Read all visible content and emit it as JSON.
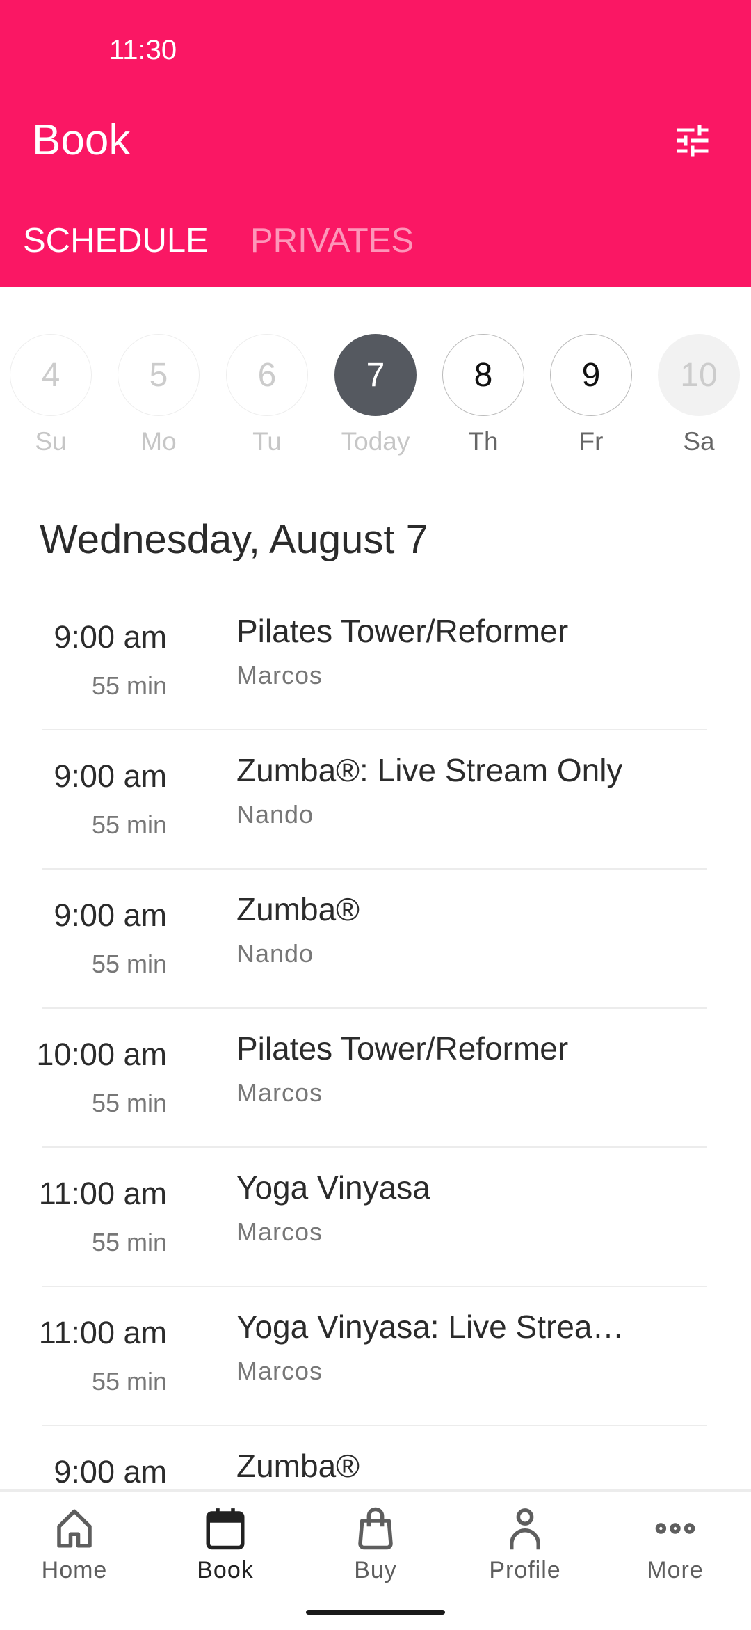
{
  "status_bar": {
    "time": "11:30"
  },
  "header": {
    "title": "Book",
    "filter_icon": "sliders-icon",
    "brand_color": "#fa1764"
  },
  "tabs": [
    {
      "label": "SCHEDULE",
      "active": true
    },
    {
      "label": "PRIVATES",
      "active": false
    }
  ],
  "days": [
    {
      "num": "4",
      "label": "Su",
      "state": "past"
    },
    {
      "num": "5",
      "label": "Mo",
      "state": "past"
    },
    {
      "num": "6",
      "label": "Tu",
      "state": "past"
    },
    {
      "num": "7",
      "label": "Today",
      "state": "selected"
    },
    {
      "num": "8",
      "label": "Th",
      "state": "future"
    },
    {
      "num": "9",
      "label": "Fr",
      "state": "future"
    },
    {
      "num": "10",
      "label": "Sa",
      "state": "disabled"
    }
  ],
  "date_heading": "Wednesday, August 7",
  "classes": [
    {
      "time": "9:00 am",
      "duration": "55 min",
      "name": "Pilates Tower/Reformer",
      "instructor": "Marcos"
    },
    {
      "time": "9:00 am",
      "duration": "55 min",
      "name": "Zumba®: Live Stream Only",
      "instructor": "Nando"
    },
    {
      "time": "9:00 am",
      "duration": "55 min",
      "name": "Zumba®",
      "instructor": "Nando"
    },
    {
      "time": "10:00 am",
      "duration": "55 min",
      "name": "Pilates Tower/Reformer",
      "instructor": "Marcos"
    },
    {
      "time": "11:00 am",
      "duration": "55 min",
      "name": "Yoga Vinyasa",
      "instructor": "Marcos"
    },
    {
      "time": "11:00 am",
      "duration": "55 min",
      "name": "Yoga Vinyasa: Live Strea…",
      "instructor": "Marcos"
    },
    {
      "time": "9:00 am",
      "duration": "",
      "name": "Zumba®",
      "instructor": ""
    }
  ],
  "nav": [
    {
      "label": "Home",
      "icon": "home-icon"
    },
    {
      "label": "Book",
      "icon": "calendar-icon",
      "active": true
    },
    {
      "label": "Buy",
      "icon": "shopping-bag-icon"
    },
    {
      "label": "Profile",
      "icon": "person-icon"
    },
    {
      "label": "More",
      "icon": "more-icon"
    }
  ]
}
